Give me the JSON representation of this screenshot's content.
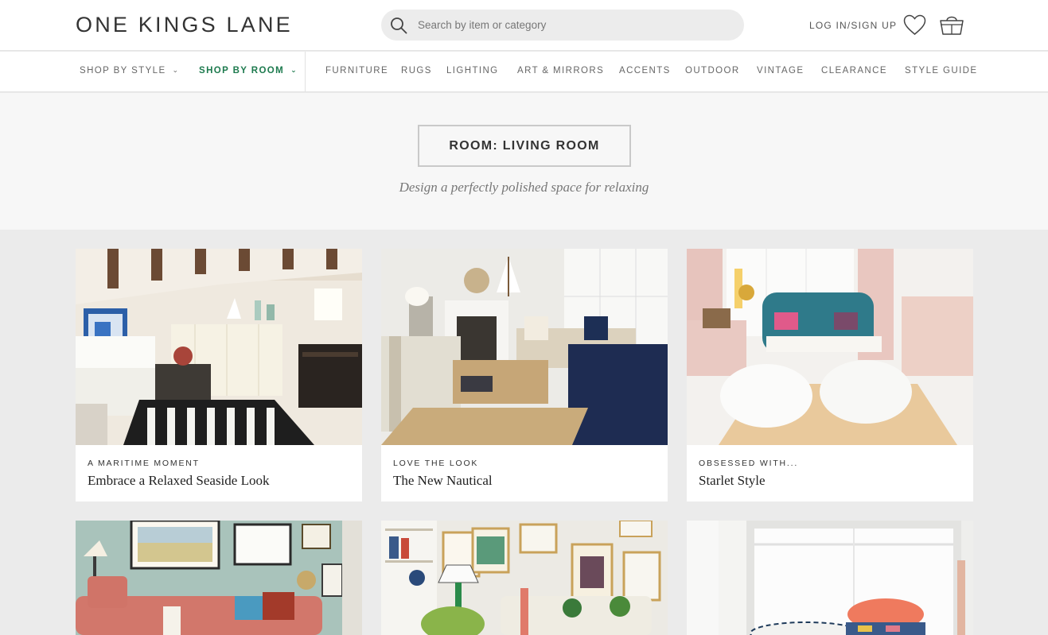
{
  "header": {
    "logo": "ONE KINGS LANE",
    "search_placeholder": "Search by item or category",
    "login": "LOG IN/SIGN UP"
  },
  "nav": {
    "items": [
      {
        "label": "SHOP BY STYLE",
        "dropdown": true
      },
      {
        "label": "SHOP BY ROOM",
        "dropdown": true,
        "active": true
      },
      {
        "label": "FURNITURE"
      },
      {
        "label": "RUGS"
      },
      {
        "label": "LIGHTING"
      },
      {
        "label": "ART & MIRRORS"
      },
      {
        "label": "ACCENTS"
      },
      {
        "label": "OUTDOOR"
      },
      {
        "label": "VINTAGE"
      },
      {
        "label": "CLEARANCE"
      },
      {
        "label": "STYLE GUIDE"
      }
    ],
    "chevron": "⌄"
  },
  "hero": {
    "title": "ROOM: LIVING ROOM",
    "tagline": "Design a perfectly polished space for relaxing"
  },
  "cards": [
    {
      "kicker": "A MARITIME MOMENT",
      "title": "Embrace a Relaxed Seaside Look"
    },
    {
      "kicker": "LOVE THE LOOK",
      "title": "The New Nautical"
    },
    {
      "kicker": "OBSESSED WITH...",
      "title": "Starlet Style"
    },
    {
      "kicker": "",
      "title": ""
    },
    {
      "kicker": "",
      "title": ""
    },
    {
      "kicker": "",
      "title": ""
    }
  ],
  "colors": {
    "accent_green": "#1d7a4e",
    "page_bg": "#ebebeb",
    "hero_bg": "#f7f7f7"
  }
}
